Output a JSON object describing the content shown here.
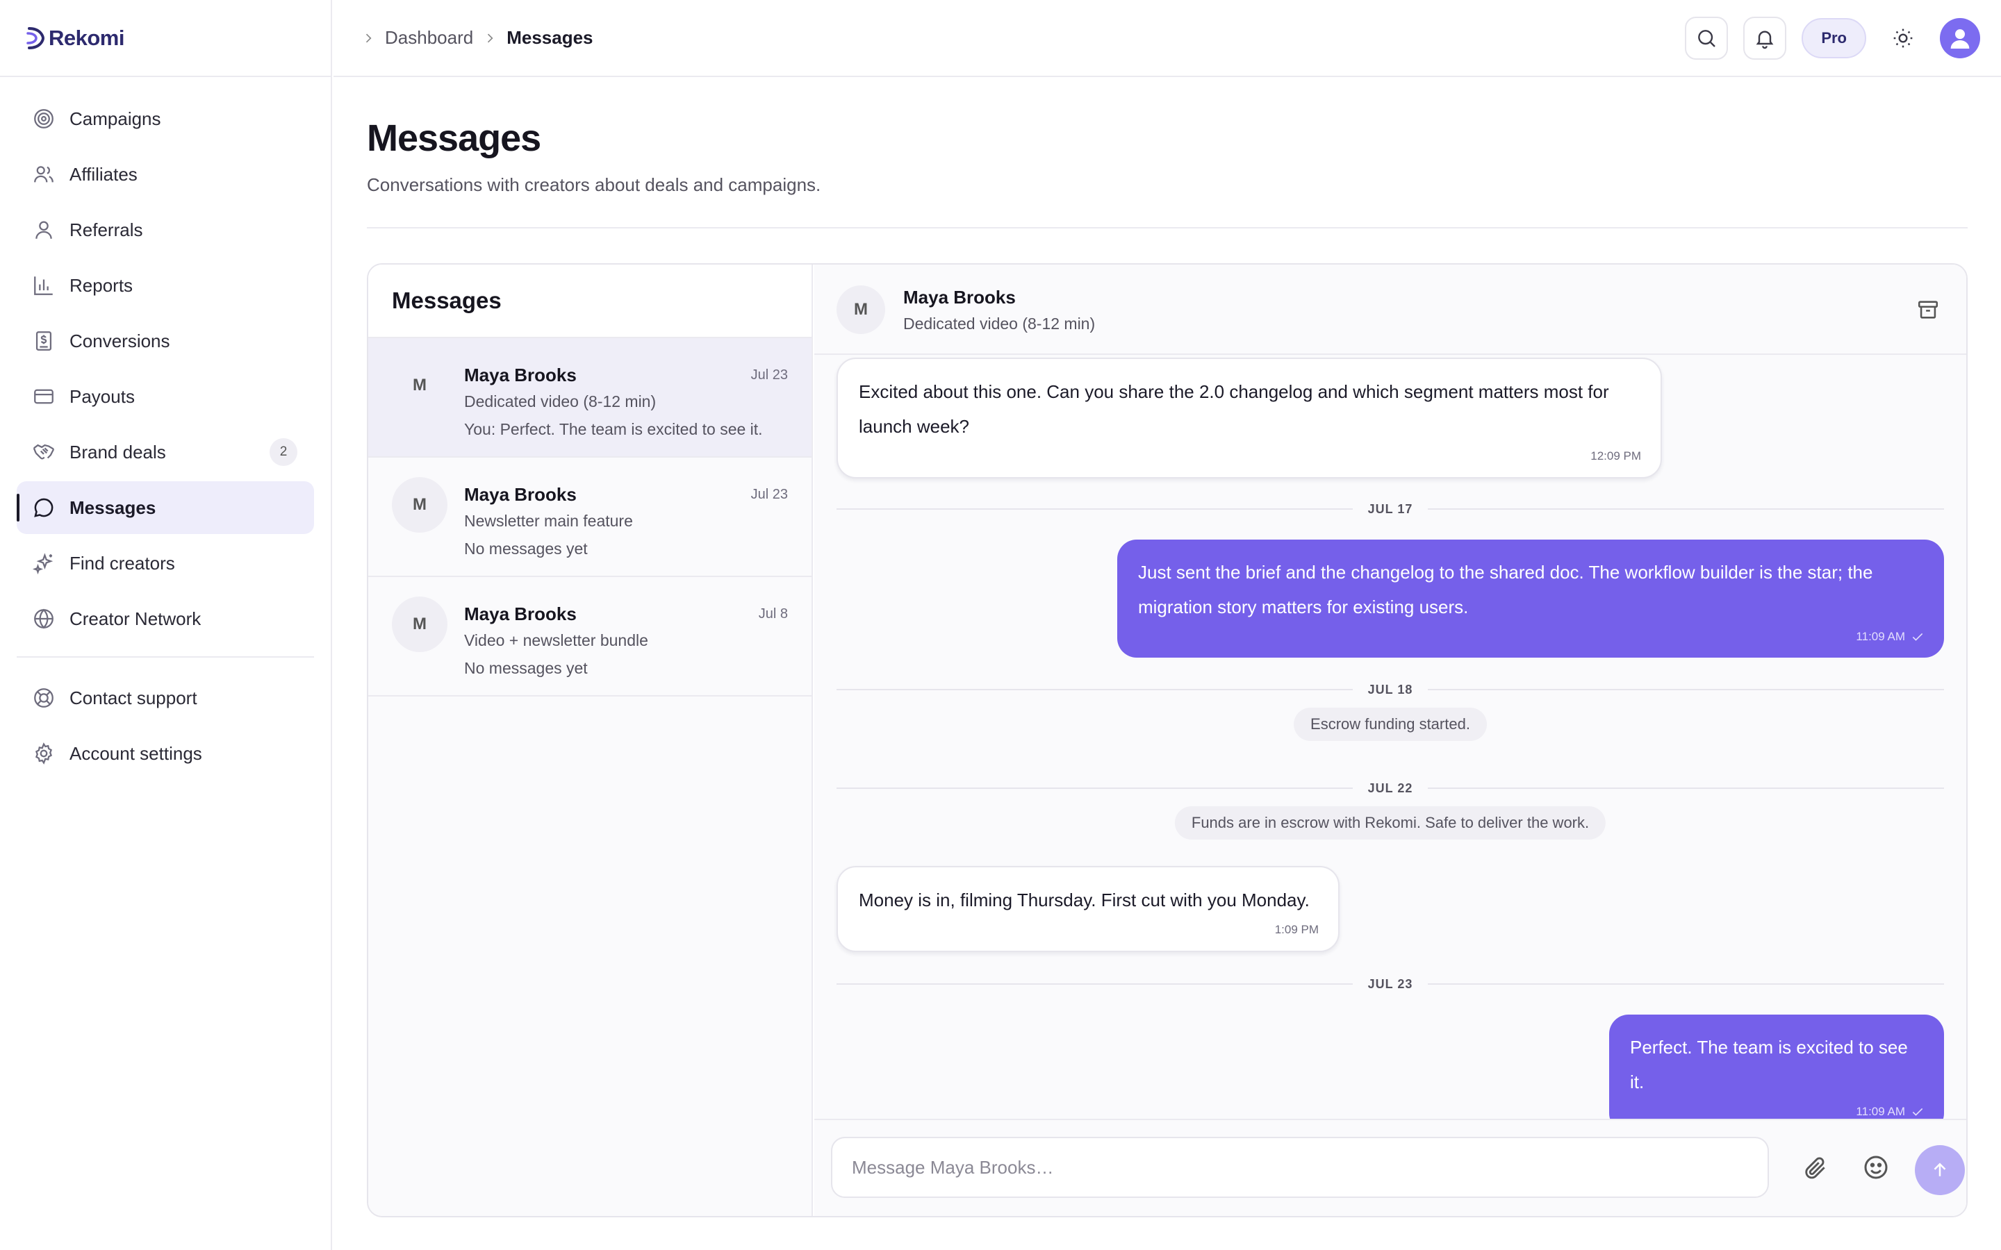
{
  "brand": {
    "name": "Rekomi",
    "accent": "#7560ea"
  },
  "sidebar": {
    "items": [
      {
        "label": "Campaigns",
        "icon": "target-icon"
      },
      {
        "label": "Affiliates",
        "icon": "users-icon"
      },
      {
        "label": "Referrals",
        "icon": "user-icon"
      },
      {
        "label": "Reports",
        "icon": "bar-chart-icon"
      },
      {
        "label": "Conversions",
        "icon": "receipt-dollar-icon"
      },
      {
        "label": "Payouts",
        "icon": "credit-card-icon"
      },
      {
        "label": "Brand deals",
        "icon": "handshake-icon",
        "badge": "2"
      },
      {
        "label": "Messages",
        "icon": "chat-bubble-icon",
        "active": true
      },
      {
        "label": "Find creators",
        "icon": "sparkles-icon"
      },
      {
        "label": "Creator Network",
        "icon": "globe-icon"
      }
    ],
    "footer_items": [
      {
        "label": "Contact support",
        "icon": "lifebuoy-icon"
      },
      {
        "label": "Account settings",
        "icon": "gear-icon"
      }
    ]
  },
  "topbar": {
    "breadcrumb": [
      "Dashboard",
      "Messages"
    ],
    "plan_label": "Pro"
  },
  "page": {
    "title": "Messages",
    "subtitle": "Conversations with creators about deals and campaigns."
  },
  "conversations": {
    "heading": "Messages",
    "items": [
      {
        "initial": "M",
        "name": "Maya Brooks",
        "deal": "Dedicated video (8-12 min)",
        "last": "You: Perfect. The team is excited to see it.",
        "date": "Jul 23",
        "active": true
      },
      {
        "initial": "M",
        "name": "Maya Brooks",
        "deal": "Newsletter main feature",
        "last": "No messages yet",
        "date": "Jul 23"
      },
      {
        "initial": "M",
        "name": "Maya Brooks",
        "deal": "Video + newsletter bundle",
        "last": "No messages yet",
        "date": "Jul 8"
      }
    ]
  },
  "chat": {
    "initial": "M",
    "name": "Maya Brooks",
    "deal": "Dedicated video (8-12 min)",
    "messages": [
      {
        "kind": "in",
        "text": "Excited about this one. Can you share the 2.0 changelog and which segment matters most for launch week?",
        "time": "12:09 PM"
      },
      {
        "kind": "day",
        "text": "JUL 17"
      },
      {
        "kind": "out",
        "text": "Just sent the brief and the changelog to the shared doc. The workflow builder is the star; the migration story matters for existing users.",
        "time": "11:09 AM"
      },
      {
        "kind": "day",
        "text": "JUL 18"
      },
      {
        "kind": "system",
        "text": "Escrow funding started."
      },
      {
        "kind": "day",
        "text": "JUL 22"
      },
      {
        "kind": "system",
        "text": "Funds are in escrow with Rekomi. Safe to deliver the work."
      },
      {
        "kind": "in",
        "text": "Money is in, filming Thursday. First cut with you Monday.",
        "time": "1:09 PM"
      },
      {
        "kind": "day",
        "text": "JUL 23"
      },
      {
        "kind": "out",
        "text": "Perfect. The team is excited to see it.",
        "time": "11:09 AM"
      }
    ],
    "composer_placeholder": "Message Maya Brooks…"
  }
}
